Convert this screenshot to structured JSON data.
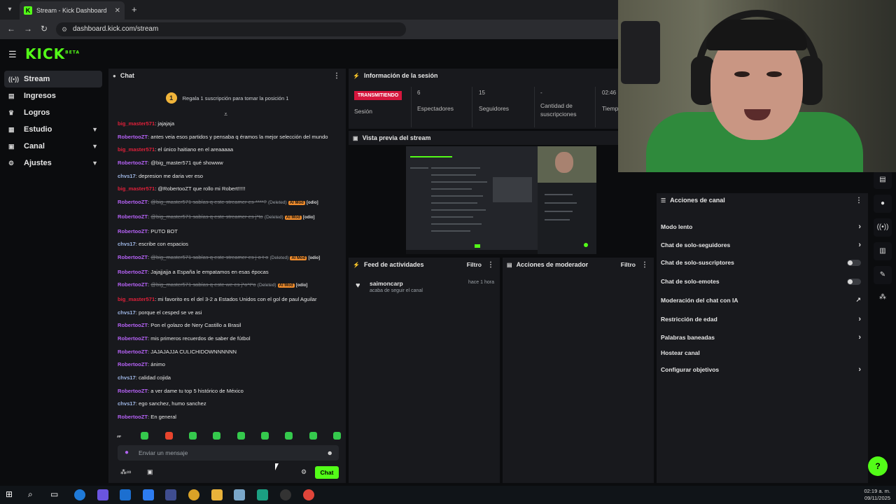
{
  "browser": {
    "tab_title": "Stream - Kick Dashboard",
    "tab_favicon": "K",
    "url": "dashboard.kick.com/stream"
  },
  "logo": {
    "text": "KICK",
    "badge": "BETA"
  },
  "sidebar": {
    "items": [
      {
        "label": "Stream",
        "icon": "broadcast-icon",
        "active": true,
        "chevron": false
      },
      {
        "label": "Ingresos",
        "icon": "money-icon",
        "chevron": false
      },
      {
        "label": "Logros",
        "icon": "trophy-icon",
        "chevron": false
      },
      {
        "label": "Estudio",
        "icon": "studio-icon",
        "chevron": true
      },
      {
        "label": "Canal",
        "icon": "channel-icon",
        "chevron": true
      },
      {
        "label": "Ajustes",
        "icon": "gear-icon",
        "chevron": true
      }
    ]
  },
  "chat": {
    "title": "Chat",
    "sub_gift_num": "1",
    "sub_gift_text": "Regala 1 suscripción para tomar la posición 1",
    "input_placeholder": "Enviar un mensaje",
    "send_label": "Chat",
    "messages": [
      {
        "user": "big_master571",
        "color": "#e0203a",
        "text": "jajajaja"
      },
      {
        "user": "RobertooZT",
        "color": "#b562f5",
        "text": "antes veia esos partidos y pensaba q éramos la mejor selección del mundo",
        "wrap": true
      },
      {
        "user": "big_master571",
        "color": "#e0203a",
        "text": "el único haitiano en el areaaaaa"
      },
      {
        "user": "RobertooZT",
        "color": "#b562f5",
        "text": "@big_master571 qué showww"
      },
      {
        "user": "chvs17",
        "color": "#9fb7e5",
        "text": "depresion me daria ver eso"
      },
      {
        "user": "big_master571",
        "color": "#e0203a",
        "text": "@RobertooZT que rollo mi Robert!!!!!"
      },
      {
        "user": "RobertooZT",
        "color": "#b562f5",
        "deleted": "@big_master571 sabías q este streamer es ****?",
        "tag": "(Deleted)",
        "mod": "AI Mod",
        "reason": "[odio]"
      },
      {
        "user": "RobertooZT",
        "color": "#b562f5",
        "deleted": "@big_master571 sabías q este streamer es j*to",
        "tag": "(Deleted)",
        "mod": "AI Mod",
        "reason": "[odio]"
      },
      {
        "user": "RobertooZT",
        "color": "#b562f5",
        "text": "PUTO BOT"
      },
      {
        "user": "chvs17",
        "color": "#9fb7e5",
        "text": "escribe con espacios"
      },
      {
        "user": "RobertooZT",
        "color": "#b562f5",
        "deleted": "@big_master571 sabías q este streamer es j o t o",
        "tag": "(Deleted)",
        "mod": "AI Mod",
        "reason": "[odio]"
      },
      {
        "user": "RobertooZT",
        "color": "#b562f5",
        "text": "Jajajjajja a España le empatamos en esas épocas"
      },
      {
        "user": "RobertooZT",
        "color": "#b562f5",
        "deleted": "@big_master571 sabías q este we es j*o*t*o",
        "tag": "(Deleted)",
        "mod": "AI Mod",
        "reason": "[odio]"
      },
      {
        "user": "big_master571",
        "color": "#e0203a",
        "text": "mi favorito es el del 3-2 a Estados Unidos con el gol de paul Aguilar"
      },
      {
        "user": "chvs17",
        "color": "#9fb7e5",
        "text": "porque el cesped se ve asi"
      },
      {
        "user": "RobertooZT",
        "color": "#b562f5",
        "text": "Pon el golazo de Nery Castillo a Brasil"
      },
      {
        "user": "RobertooZT",
        "color": "#b562f5",
        "text": "mis primeros recuerdos de saber de fútbol"
      },
      {
        "user": "RobertooZT",
        "color": "#b562f5",
        "text": "JAJAJAJJA CULICHIDOWNNNNNN"
      },
      {
        "user": "RobertooZT",
        "color": "#b562f5",
        "text": "ánimo"
      },
      {
        "user": "chvs17",
        "color": "#9fb7e5",
        "text": "calidad cojida"
      },
      {
        "user": "RobertooZT",
        "color": "#b562f5",
        "text": "a ver dame tu top 5 histórico de México"
      },
      {
        "user": "chvs17",
        "color": "#9fb7e5",
        "text": "ego sanchez, humo sanchez"
      },
      {
        "user": "RobertooZT",
        "color": "#b562f5",
        "text": "En general"
      }
    ]
  },
  "session": {
    "title": "Información de la sesión",
    "status": "TRANSMITIENDO",
    "status_label": "Sesión",
    "stats": [
      {
        "value": "6",
        "label": "Espectadores"
      },
      {
        "value": "15",
        "label": "Seguidores"
      },
      {
        "value": "-",
        "label": "Cantidad de suscripciones"
      },
      {
        "value": "02:46",
        "label": "Tiempo"
      }
    ]
  },
  "preview": {
    "title": "Vista previa del stream"
  },
  "feed": {
    "title": "Feed de actividades",
    "filter": "Filtro",
    "items": [
      {
        "user": "saimoncarp",
        "action": "acaba de seguir el canal",
        "time": "hace 1 hora"
      }
    ]
  },
  "moderator": {
    "title": "Acciones de moderador",
    "filter": "Filtro"
  },
  "channel_actions": {
    "title": "Acciones de canal",
    "items": [
      {
        "label": "Modo lento",
        "control": "chevron"
      },
      {
        "label": "Chat de solo-seguidores",
        "control": "chevron"
      },
      {
        "label": "Chat de solo-suscriptores",
        "control": "toggle"
      },
      {
        "label": "Chat de solo-emotes",
        "control": "toggle"
      },
      {
        "label": "Moderación del chat con IA",
        "control": "external"
      },
      {
        "label": "Restricción de edad",
        "control": "chevron"
      },
      {
        "label": "Palabras baneadas",
        "control": "chevron"
      },
      {
        "label": "Hostear canal",
        "control": "none"
      },
      {
        "label": "Configurar objetivos",
        "control": "chevron"
      }
    ]
  },
  "taskbar": {
    "time": "02:19 a. m.",
    "date": "09/11/2025"
  }
}
